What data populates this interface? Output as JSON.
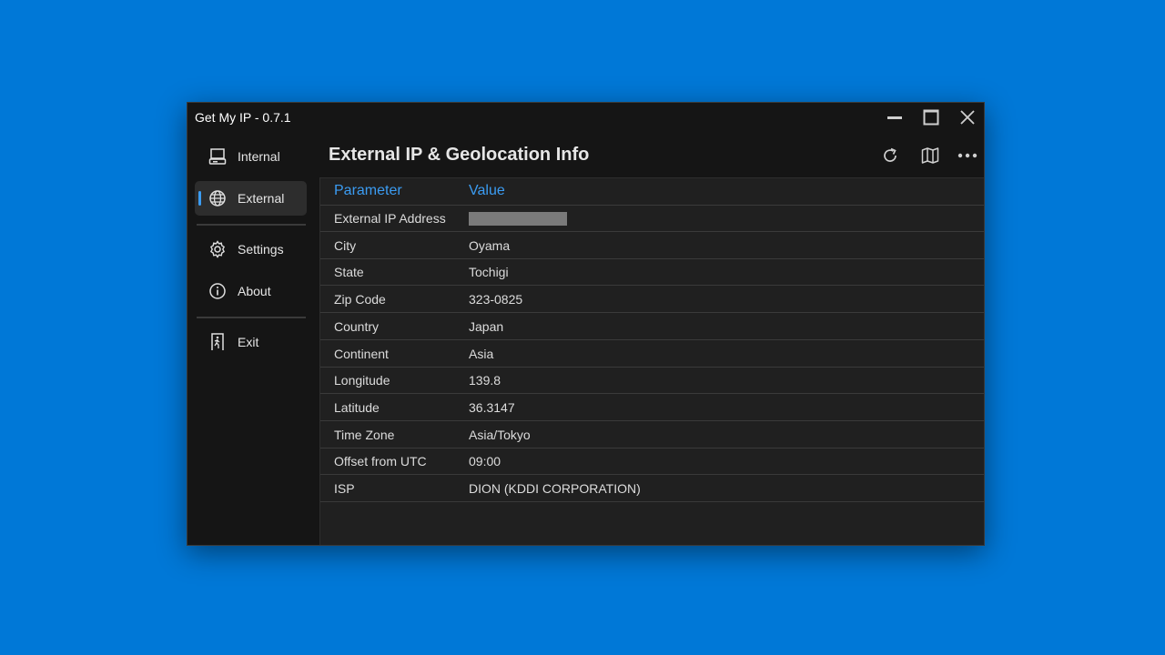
{
  "window": {
    "title": "Get My IP - 0.7.1"
  },
  "sidebar": {
    "items": [
      {
        "label": "Internal",
        "icon": "computer-icon",
        "active": false
      },
      {
        "label": "External",
        "icon": "globe-icon",
        "active": true
      },
      {
        "label": "Settings",
        "icon": "gear-icon",
        "active": false
      },
      {
        "label": "About",
        "icon": "info-icon",
        "active": false
      },
      {
        "label": "Exit",
        "icon": "exit-icon",
        "active": false
      }
    ]
  },
  "header": {
    "title": "External IP & Geolocation Info"
  },
  "toolbar": {
    "icons": [
      "refresh-icon",
      "map-icon",
      "more-icon"
    ]
  },
  "table": {
    "columns": [
      "Parameter",
      "Value"
    ],
    "rows": [
      {
        "param": "External IP Address",
        "value": "",
        "redacted": true
      },
      {
        "param": "City",
        "value": "Oyama"
      },
      {
        "param": "State",
        "value": "Tochigi"
      },
      {
        "param": "Zip Code",
        "value": "323-0825"
      },
      {
        "param": "Country",
        "value": "Japan"
      },
      {
        "param": "Continent",
        "value": "Asia"
      },
      {
        "param": "Longitude",
        "value": "139.8"
      },
      {
        "param": "Latitude",
        "value": "36.3147"
      },
      {
        "param": "Time Zone",
        "value": "Asia/Tokyo"
      },
      {
        "param": "Offset from UTC",
        "value": "09:00"
      },
      {
        "param": "ISP",
        "value": "DION (KDDI CORPORATION)"
      }
    ]
  },
  "colors": {
    "accent": "#3b9cf2",
    "desktop": "#0078d7",
    "window_bg": "#151515",
    "content_bg": "#202020"
  }
}
